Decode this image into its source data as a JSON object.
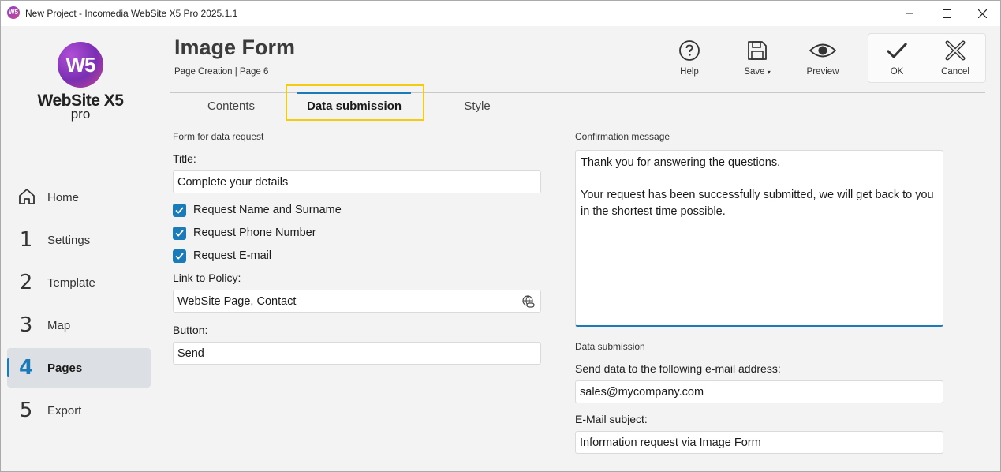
{
  "window": {
    "title": "New Project - Incomedia WebSite X5 Pro 2025.1.1"
  },
  "logo": {
    "mark": "W5",
    "name": "WebSite X5",
    "edition": "pro"
  },
  "nav": [
    {
      "num": "",
      "label": "Home",
      "icon": "home-icon"
    },
    {
      "num": "1",
      "label": "Settings"
    },
    {
      "num": "2",
      "label": "Template"
    },
    {
      "num": "3",
      "label": "Map"
    },
    {
      "num": "4",
      "label": "Pages",
      "active": true
    },
    {
      "num": "5",
      "label": "Export"
    }
  ],
  "header": {
    "title": "Image Form",
    "breadcrumb": "Page Creation | Page 6"
  },
  "toolbar": {
    "help": "Help",
    "save": "Save",
    "preview": "Preview",
    "ok": "OK",
    "cancel": "Cancel"
  },
  "tabs": [
    {
      "label": "Contents"
    },
    {
      "label": "Data submission",
      "active": true
    },
    {
      "label": "Style"
    }
  ],
  "form": {
    "section": "Form for data request",
    "title_label": "Title:",
    "title_value": "Complete your details",
    "checkboxes": [
      {
        "label": "Request Name and Surname",
        "checked": true
      },
      {
        "label": "Request Phone Number",
        "checked": true
      },
      {
        "label": "Request E-mail",
        "checked": true
      }
    ],
    "policy_label": "Link to Policy:",
    "policy_value": "WebSite Page, Contact",
    "button_label": "Button:",
    "button_value": "Send"
  },
  "confirmation": {
    "section": "Confirmation message",
    "message": "Thank you for answering the questions.\n\nYour request has been successfully submitted, we will get back to you in the shortest time possible."
  },
  "submission": {
    "section": "Data submission",
    "email_label": "Send data to the following e-mail address:",
    "email_value": "sales@mycompany.com",
    "subject_label": "E-Mail subject:",
    "subject_value": "Information request via Image Form"
  },
  "colors": {
    "accent": "#1a7bb8",
    "highlight": "#f5cb12"
  }
}
